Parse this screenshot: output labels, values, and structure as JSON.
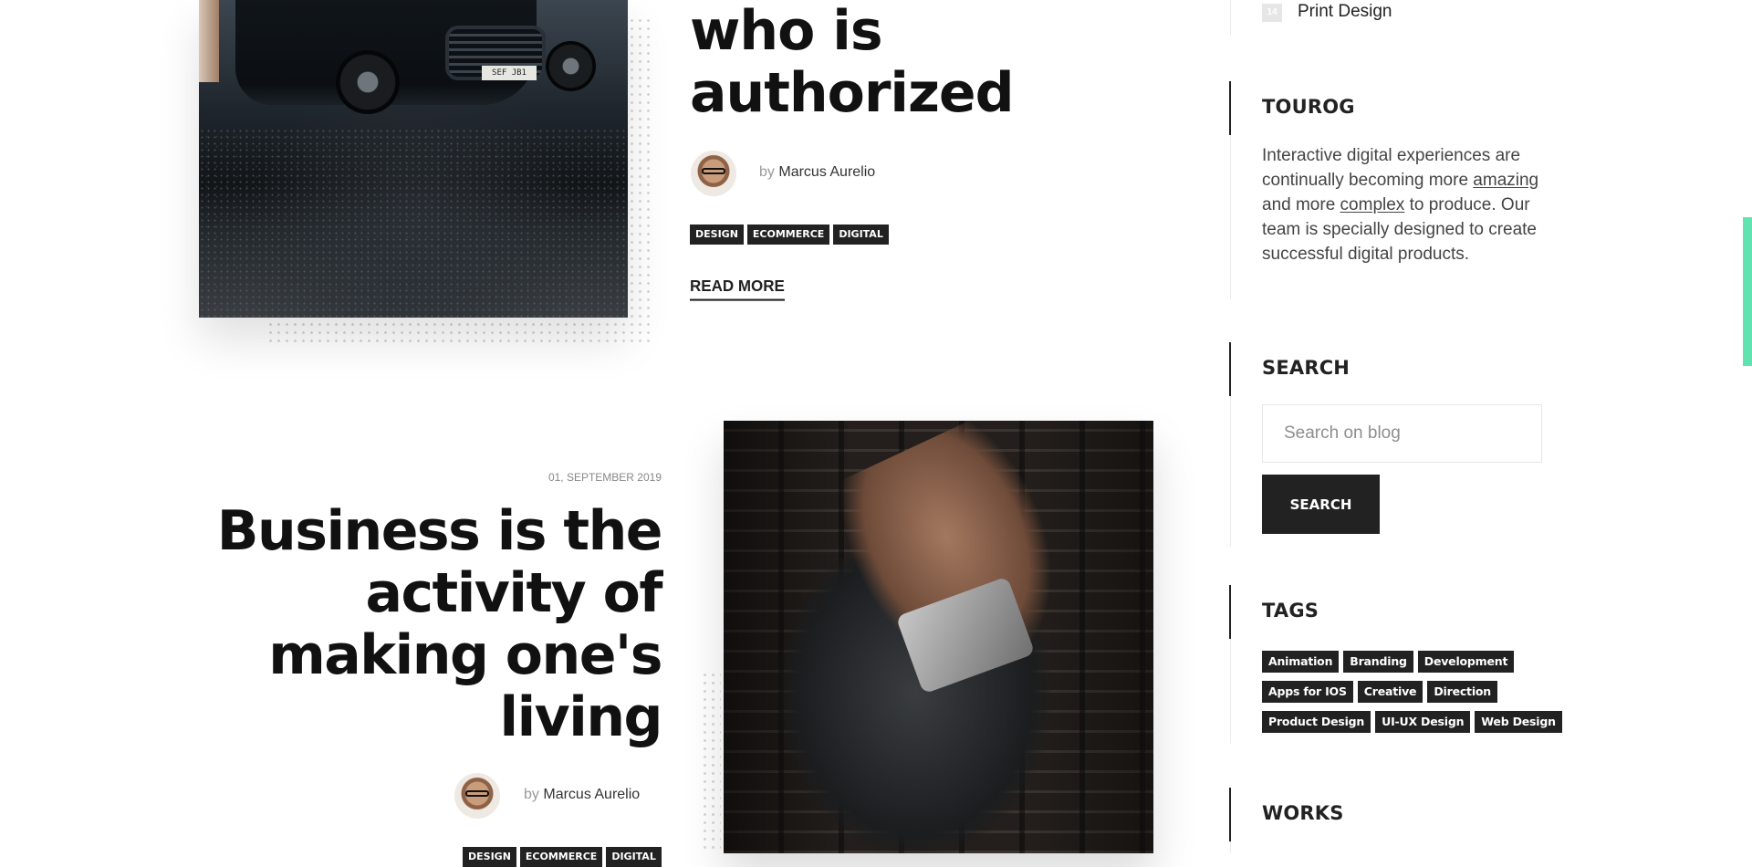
{
  "post1": {
    "title_lines": [
      "who is",
      "authorized"
    ],
    "author_prefix": "by",
    "author": "Marcus Aurelio",
    "tags": [
      "DESIGN",
      "ECOMMERCE",
      "DIGITAL"
    ],
    "read_more": "READ MORE",
    "image": {
      "plate": "SEF JB1"
    }
  },
  "post2": {
    "date": "01, SEPTEMBER 2019",
    "title_lines": [
      "Business is the",
      "activity of",
      "making one's",
      "living"
    ],
    "author_prefix": "by",
    "author": "Marcus Aurelio",
    "tags": [
      "DESIGN",
      "ECOMMERCE",
      "DIGITAL"
    ]
  },
  "sidebar": {
    "categories": [
      {
        "count": "14",
        "label": "Print Design"
      }
    ],
    "about": {
      "heading": "TOUROG",
      "text_before": "Interactive digital experiences are continually becoming more ",
      "link1": "amazing",
      "text_middle": " and more ",
      "link2": "complex",
      "text_after": " to produce. Our team is specially designed to create successful digital products."
    },
    "search": {
      "heading": "SEARCH",
      "placeholder": "Search on blog",
      "button": "SEARCH"
    },
    "tags": {
      "heading": "TAGS",
      "rows": [
        [
          "Animation",
          "Branding",
          "Development"
        ],
        [
          "Apps for IOS",
          "Creative",
          "Direction"
        ],
        [
          "Product Design",
          "UI-UX Design",
          "Web Design"
        ]
      ]
    },
    "works": {
      "heading": "WORKS"
    }
  },
  "colors": {
    "accent": "#5fe3b0",
    "dark": "#222222",
    "text": "#111111"
  }
}
